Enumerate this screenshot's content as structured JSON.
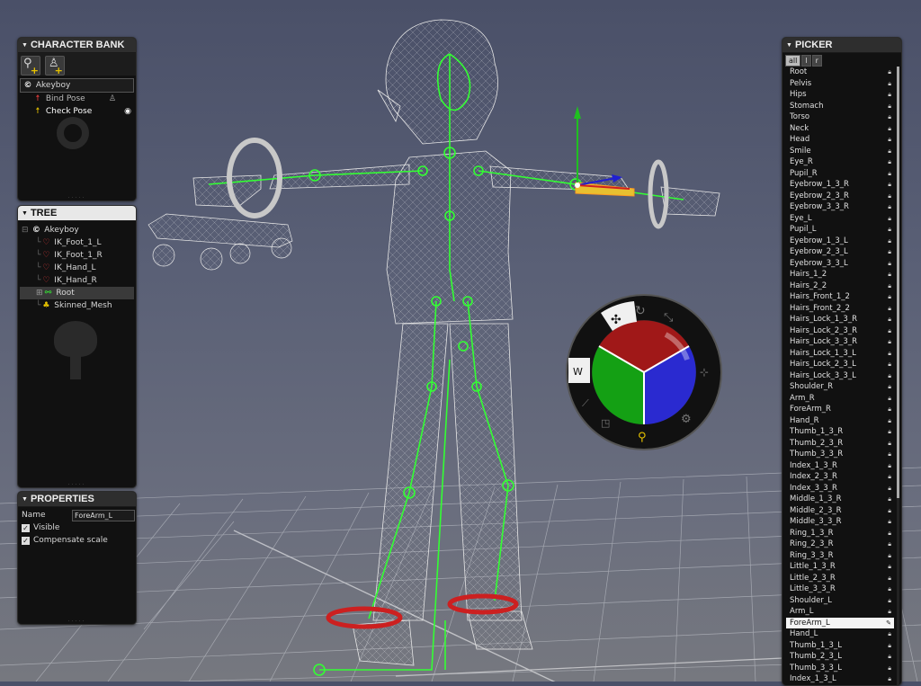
{
  "character_bank": {
    "title": "CHARACTER BANK",
    "tools": [
      "add-character-icon",
      "add-pose-icon"
    ],
    "character": "Akeyboy",
    "poses": [
      {
        "label": "Bind Pose",
        "icon": "bind-pose-icon",
        "color": "#e03a3a"
      },
      {
        "label": "Check Pose",
        "icon": "check-pose-icon",
        "color": "#e6c200"
      }
    ]
  },
  "tree": {
    "title": "TREE",
    "nodes": [
      {
        "label": "Akeyboy",
        "icon": "character-icon"
      },
      {
        "label": "IK_Foot_1_L",
        "icon": "ik-effector-icon"
      },
      {
        "label": "IK_Foot_1_R",
        "icon": "ik-effector-icon"
      },
      {
        "label": "IK_Hand_L",
        "icon": "ik-effector-icon"
      },
      {
        "label": "IK_Hand_R",
        "icon": "ik-effector-icon"
      },
      {
        "label": "Root",
        "icon": "bone-root-icon"
      },
      {
        "label": "Skinned_Mesh",
        "icon": "mesh-icon"
      }
    ]
  },
  "properties": {
    "title": "PROPERTIES",
    "name_label": "Name",
    "name_value": "ForeArm_L",
    "visible_label": "Visible",
    "visible_checked": "✓",
    "compensate_label": "Compensate scale",
    "compensate_checked": "✓"
  },
  "picker": {
    "title": "PICKER",
    "tabs": [
      "all",
      "l",
      "r"
    ],
    "items": [
      "Root",
      "Pelvis",
      "Hips",
      "Stomach",
      "Torso",
      "Neck",
      "Head",
      "Smile",
      "Eye_R",
      "Pupil_R",
      "Eyebrow_1_3_R",
      "Eyebrow_2_3_R",
      "Eyebrow_3_3_R",
      "Eye_L",
      "Pupil_L",
      "Eyebrow_1_3_L",
      "Eyebrow_2_3_L",
      "Eyebrow_3_3_L",
      "Hairs_1_2",
      "Hairs_2_2",
      "Hairs_Front_1_2",
      "Hairs_Front_2_2",
      "Hairs_Lock_1_3_R",
      "Hairs_Lock_2_3_R",
      "Hairs_Lock_3_3_R",
      "Hairs_Lock_1_3_L",
      "Hairs_Lock_2_3_L",
      "Hairs_Lock_3_3_L",
      "Shoulder_R",
      "Arm_R",
      "ForeArm_R",
      "Hand_R",
      "Thumb_1_3_R",
      "Thumb_2_3_R",
      "Thumb_3_3_R",
      "Index_1_3_R",
      "Index_2_3_R",
      "Index_3_3_R",
      "Middle_1_3_R",
      "Middle_2_3_R",
      "Middle_3_3_R",
      "Ring_1_3_R",
      "Ring_2_3_R",
      "Ring_3_3_R",
      "Little_1_3_R",
      "Little_2_3_R",
      "Little_3_3_R",
      "Shoulder_L",
      "Arm_L",
      "ForeArm_L",
      "Hand_L",
      "Thumb_1_3_L",
      "Thumb_2_3_L",
      "Thumb_3_3_L",
      "Index_1_3_L"
    ],
    "selected": "ForeArm_L"
  },
  "pie_menu": {
    "center_sectors": [
      "x-axis-red",
      "y-axis-green",
      "z-axis-blue"
    ],
    "buttons": [
      "translate-icon",
      "rotate-icon",
      "scale-icon",
      "axis-icon",
      "settings-icon",
      "character-pose-icon",
      "keyframe-icon",
      "ik-fk-icon"
    ]
  },
  "colors": {
    "accent_green": "#33ff33",
    "panel_bg": "#111111",
    "selection": "#f4f4f4",
    "x_axis": "#a01818",
    "y_axis": "#14a014",
    "z_axis": "#2a2ad0"
  }
}
